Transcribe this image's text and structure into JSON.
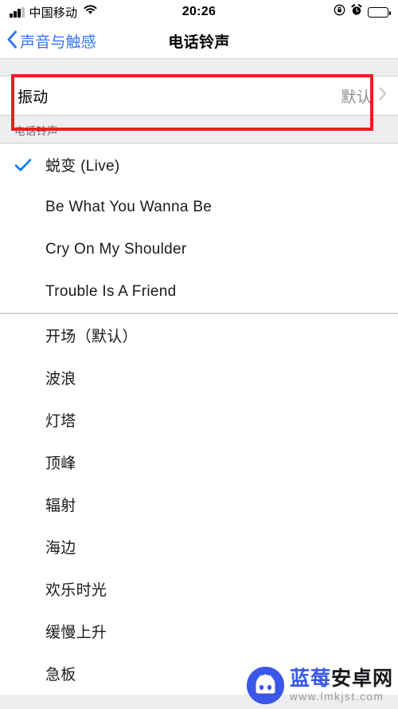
{
  "status_bar": {
    "carrier": "中国移动",
    "time": "20:26",
    "signal_icon": "cellular-signal-icon",
    "wifi_icon": "wifi-icon",
    "rotation_lock_icon": "rotation-lock-icon",
    "alarm_icon": "alarm-clock-icon",
    "battery_icon": "battery-full-icon",
    "battery_level": 100
  },
  "nav": {
    "back_label": "声音与触感",
    "title": "电话铃声",
    "back_icon": "chevron-left-icon"
  },
  "vibration": {
    "label": "振动",
    "value": "默认",
    "chevron_icon": "chevron-right-icon"
  },
  "section": {
    "header": "电话铃声"
  },
  "ringtones": {
    "custom": [
      {
        "name": "蜕变 (Live)",
        "selected": true
      },
      {
        "name": "Be What You Wanna Be",
        "selected": false
      },
      {
        "name": "Cry On My Shoulder",
        "selected": false
      },
      {
        "name": "Trouble Is A Friend",
        "selected": false
      }
    ],
    "system": [
      {
        "name": "开场（默认）",
        "selected": false
      },
      {
        "name": "波浪",
        "selected": false
      },
      {
        "name": "灯塔",
        "selected": false
      },
      {
        "name": "顶峰",
        "selected": false
      },
      {
        "name": "辐射",
        "selected": false
      },
      {
        "name": "海边",
        "selected": false
      },
      {
        "name": "欢乐时光",
        "selected": false
      },
      {
        "name": "缓慢上升",
        "selected": false
      },
      {
        "name": "急板",
        "selected": false
      }
    ]
  },
  "annotation": {
    "highlight_color": "#ee1c25"
  },
  "watermark": {
    "brand_blue": "蓝莓",
    "brand_dark": "安卓网",
    "url": "www.lmkjst.com",
    "logo_icon": "android-mascot-icon"
  },
  "colors": {
    "accent_blue": "#3478f6",
    "check_blue": "#007aff",
    "group_bg": "#eeeef0"
  }
}
